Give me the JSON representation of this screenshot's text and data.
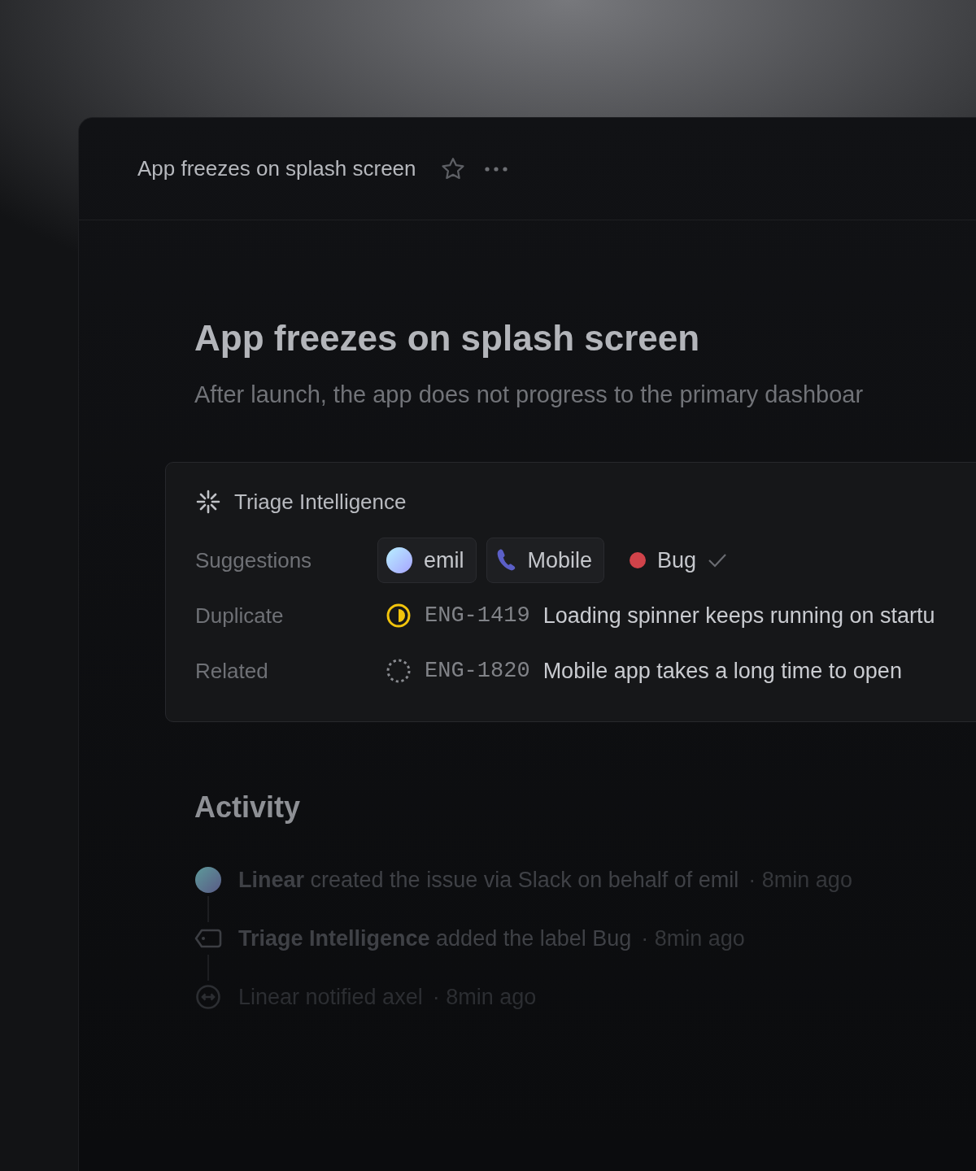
{
  "header": {
    "title": "App freezes on splash screen",
    "starred": false
  },
  "issue": {
    "title": "App freezes on splash screen",
    "description": "After launch, the app does not progress to the primary dashboar"
  },
  "triage": {
    "title": "Triage Intelligence",
    "suggestions_label": "Suggestions",
    "suggestions": [
      {
        "kind": "assignee",
        "label": "emil"
      },
      {
        "kind": "project",
        "label": "Mobile"
      },
      {
        "kind": "label",
        "label": "Bug",
        "color": "#d0434a",
        "accepted": true
      }
    ],
    "links": [
      {
        "label": "Duplicate",
        "kind": "started",
        "id": "ENG-1419",
        "title": "Loading spinner keeps running on startu"
      },
      {
        "label": "Related",
        "kind": "backlog",
        "id": "ENG-1820",
        "title": "Mobile app takes a long time to open"
      }
    ]
  },
  "activity": {
    "title": "Activity",
    "items": [
      {
        "kind": "avatar",
        "text": "**Linear** created the issue via Slack on behalf of emil",
        "time": "· 8min ago"
      },
      {
        "kind": "label",
        "text": "**Triage Intelligence** added the label Bug",
        "time": "· 8min ago"
      },
      {
        "kind": "notify",
        "text": "Linear notified axel",
        "time": "· 8min ago"
      }
    ]
  }
}
